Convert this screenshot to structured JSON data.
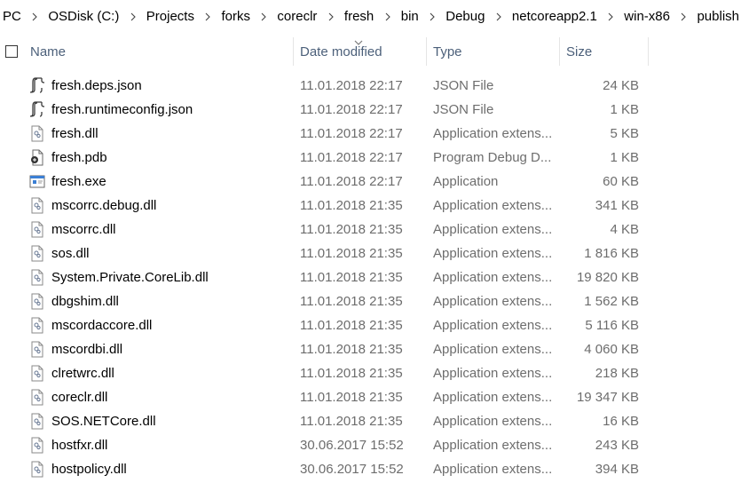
{
  "breadcrumb": [
    "PC",
    "OSDisk (C:)",
    "Projects",
    "forks",
    "coreclr",
    "fresh",
    "bin",
    "Debug",
    "netcoreapp2.1",
    "win-x86",
    "publish"
  ],
  "columns": {
    "name": "Name",
    "date": "Date modified",
    "type": "Type",
    "size": "Size"
  },
  "sort": {
    "column": "date",
    "indicator": "chevron-down-icon"
  },
  "files": [
    {
      "name": "fresh.deps.json",
      "date": "11.01.2018 22:17",
      "type": "JSON File",
      "size": "24 KB",
      "icon": "json-file-icon"
    },
    {
      "name": "fresh.runtimeconfig.json",
      "date": "11.01.2018 22:17",
      "type": "JSON File",
      "size": "1 KB",
      "icon": "json-file-icon"
    },
    {
      "name": "fresh.dll",
      "date": "11.01.2018 22:17",
      "type": "Application extens...",
      "size": "5 KB",
      "icon": "dll-file-icon"
    },
    {
      "name": "fresh.pdb",
      "date": "11.01.2018 22:17",
      "type": "Program Debug D...",
      "size": "1 KB",
      "icon": "pdb-file-icon"
    },
    {
      "name": "fresh.exe",
      "date": "11.01.2018 22:17",
      "type": "Application",
      "size": "60 KB",
      "icon": "exe-file-icon"
    },
    {
      "name": "mscorrc.debug.dll",
      "date": "11.01.2018 21:35",
      "type": "Application extens...",
      "size": "341 KB",
      "icon": "dll-file-icon"
    },
    {
      "name": "mscorrc.dll",
      "date": "11.01.2018 21:35",
      "type": "Application extens...",
      "size": "4 KB",
      "icon": "dll-file-icon"
    },
    {
      "name": "sos.dll",
      "date": "11.01.2018 21:35",
      "type": "Application extens...",
      "size": "1 816 KB",
      "icon": "dll-file-icon"
    },
    {
      "name": "System.Private.CoreLib.dll",
      "date": "11.01.2018 21:35",
      "type": "Application extens...",
      "size": "19 820 KB",
      "icon": "dll-file-icon"
    },
    {
      "name": "dbgshim.dll",
      "date": "11.01.2018 21:35",
      "type": "Application extens...",
      "size": "1 562 KB",
      "icon": "dll-file-icon"
    },
    {
      "name": "mscordaccore.dll",
      "date": "11.01.2018 21:35",
      "type": "Application extens...",
      "size": "5 116 KB",
      "icon": "dll-file-icon"
    },
    {
      "name": "mscordbi.dll",
      "date": "11.01.2018 21:35",
      "type": "Application extens...",
      "size": "4 060 KB",
      "icon": "dll-file-icon"
    },
    {
      "name": "clretwrc.dll",
      "date": "11.01.2018 21:35",
      "type": "Application extens...",
      "size": "218 KB",
      "icon": "dll-file-icon"
    },
    {
      "name": "coreclr.dll",
      "date": "11.01.2018 21:35",
      "type": "Application extens...",
      "size": "19 347 KB",
      "icon": "dll-file-icon"
    },
    {
      "name": "SOS.NETCore.dll",
      "date": "11.01.2018 21:35",
      "type": "Application extens...",
      "size": "16 KB",
      "icon": "dll-file-icon"
    },
    {
      "name": "hostfxr.dll",
      "date": "30.06.2017 15:52",
      "type": "Application extens...",
      "size": "243 KB",
      "icon": "dll-file-icon"
    },
    {
      "name": "hostpolicy.dll",
      "date": "30.06.2017 15:52",
      "type": "Application extens...",
      "size": "394 KB",
      "icon": "dll-file-icon"
    }
  ]
}
